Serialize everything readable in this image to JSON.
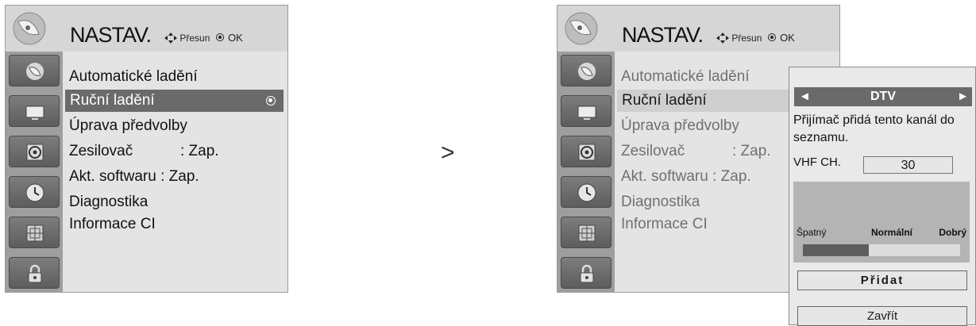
{
  "left_menu": {
    "title": "NASTAV.",
    "hint_move": "Přesun",
    "hint_ok": "OK",
    "items": [
      {
        "label": "Automatické ladění"
      },
      {
        "label": "Ruční ladění"
      },
      {
        "label": "Úprava předvolby"
      },
      {
        "label": "Zesilovač",
        "value": ": Zap."
      },
      {
        "label": "Akt. softwaru",
        "value": " : Zap."
      },
      {
        "label": "Diagnostika"
      },
      {
        "label": "Informace CI"
      }
    ]
  },
  "right_menu": {
    "title": "NASTAV.",
    "hint_move": "Přesun",
    "hint_ok": "OK",
    "items": [
      {
        "label": "Automatické ladění"
      },
      {
        "label": "Ruční ladění"
      },
      {
        "label": "Úprava předvolby"
      },
      {
        "label": "Zesilovač",
        "value": ": Zap."
      },
      {
        "label": "Akt. softwaru",
        "value": " : Zap."
      },
      {
        "label": "Diagnostika"
      },
      {
        "label": "Informace CI"
      }
    ]
  },
  "arrow": ">",
  "popup": {
    "mode": "DTV",
    "left_arrow": "◄",
    "right_arrow": "►",
    "message": "Přijímač přidá tento kanál do seznamu.",
    "channel_label": "VHF CH.",
    "channel_value": "30",
    "signal_bad": "Špatný",
    "signal_normal": "Normální",
    "signal_good": "Dobrý",
    "signal_level_percent": 42,
    "add_button": "Přidat",
    "close_button": "Zavřít"
  },
  "icons": {
    "header": "satellite-dish-icon",
    "tabs": [
      "satellite-icon",
      "tv-screen-icon",
      "speaker-icon",
      "clock-icon",
      "option-grid-icon",
      "lock-icon"
    ]
  },
  "colors": {
    "selected_row": "#6a6a6a",
    "signal_fill": "#5e5e5e"
  }
}
